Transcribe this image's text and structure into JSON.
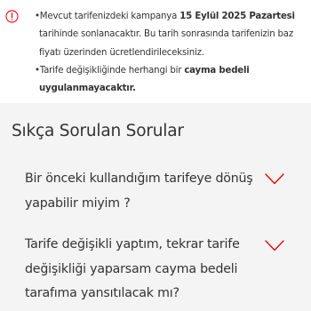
{
  "notice": {
    "icon": "info-circle-icon",
    "icon_color": "#e60000",
    "line1_prefix": "•Mevcut tarifenizdeki kampanya ",
    "line1_bold": "15 Eylül 2025 Pazartesi",
    "line2": "tarihinde sonlanacaktır. Bu tarih sonrasında tarifenizin baz",
    "line3": "fiyatı üzerinden ücretlendirileceksiniz.",
    "line4_prefix": "•Tarife değişikliğinde herhangi bir ",
    "line4_bold": "cayma bedeli",
    "line5_bold": "uygulanmayacaktır."
  },
  "faq": {
    "title": "Sıkça Sorulan Sorular",
    "background": "#f4f4f4",
    "chevron_icon": "chevron-down-icon",
    "chevron_color": "#e60000",
    "items": [
      {
        "lines": [
          "Bir önceki kullandığım tarifeye dönüş",
          "yapabilir miyim ?"
        ]
      },
      {
        "lines": [
          "Tarife değişikli yaptım, tekrar tarife",
          "değişikliği yaparsam cayma bedeli",
          "tarafıma yansıtılacak mı?"
        ]
      }
    ]
  }
}
